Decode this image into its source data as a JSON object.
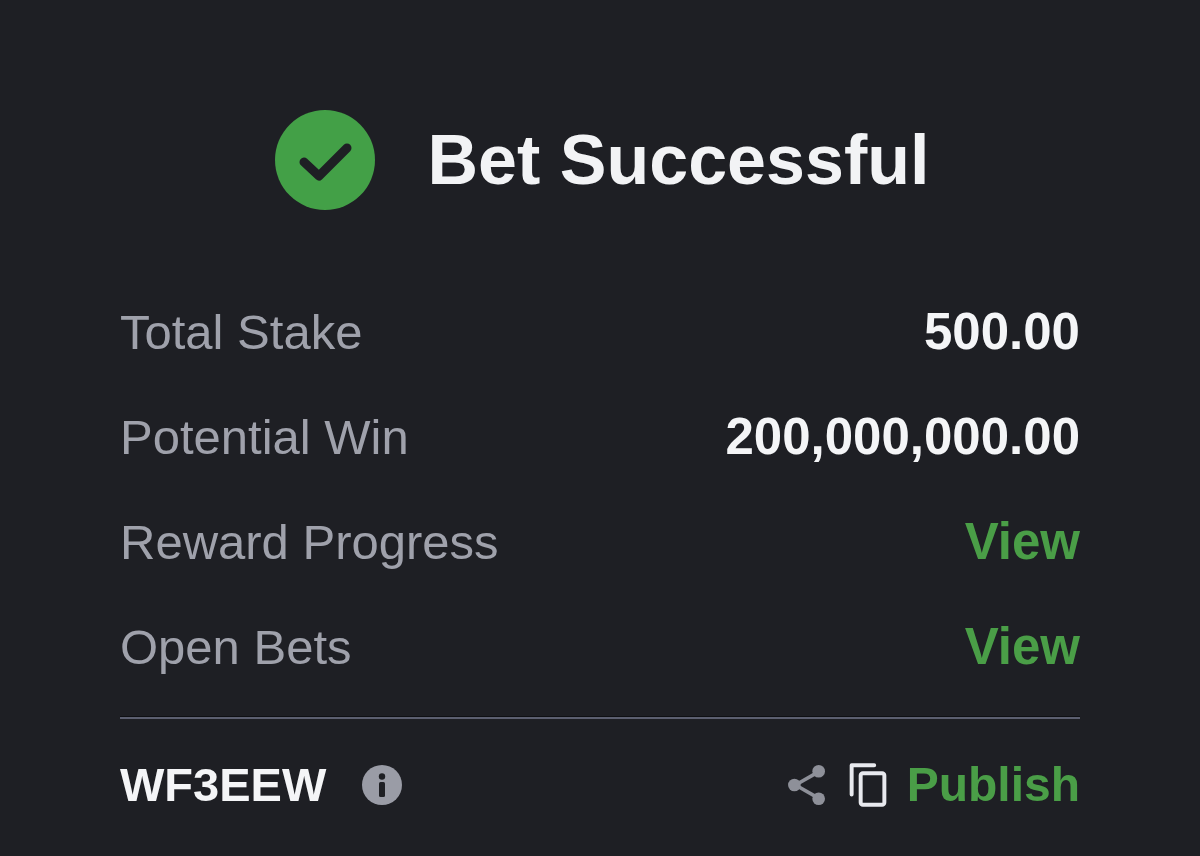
{
  "header": {
    "title": "Bet Successful"
  },
  "summary": [
    {
      "label": "Total Stake",
      "value": "500.00",
      "kind": "amount"
    },
    {
      "label": "Potential Win",
      "value": "200,000,000.00",
      "kind": "amount"
    },
    {
      "label": "Reward Progress",
      "value": "View",
      "kind": "link"
    },
    {
      "label": "Open Bets",
      "value": "View",
      "kind": "link"
    }
  ],
  "footer": {
    "booking_code": "WF3EEW",
    "publish_label": "Publish"
  }
}
